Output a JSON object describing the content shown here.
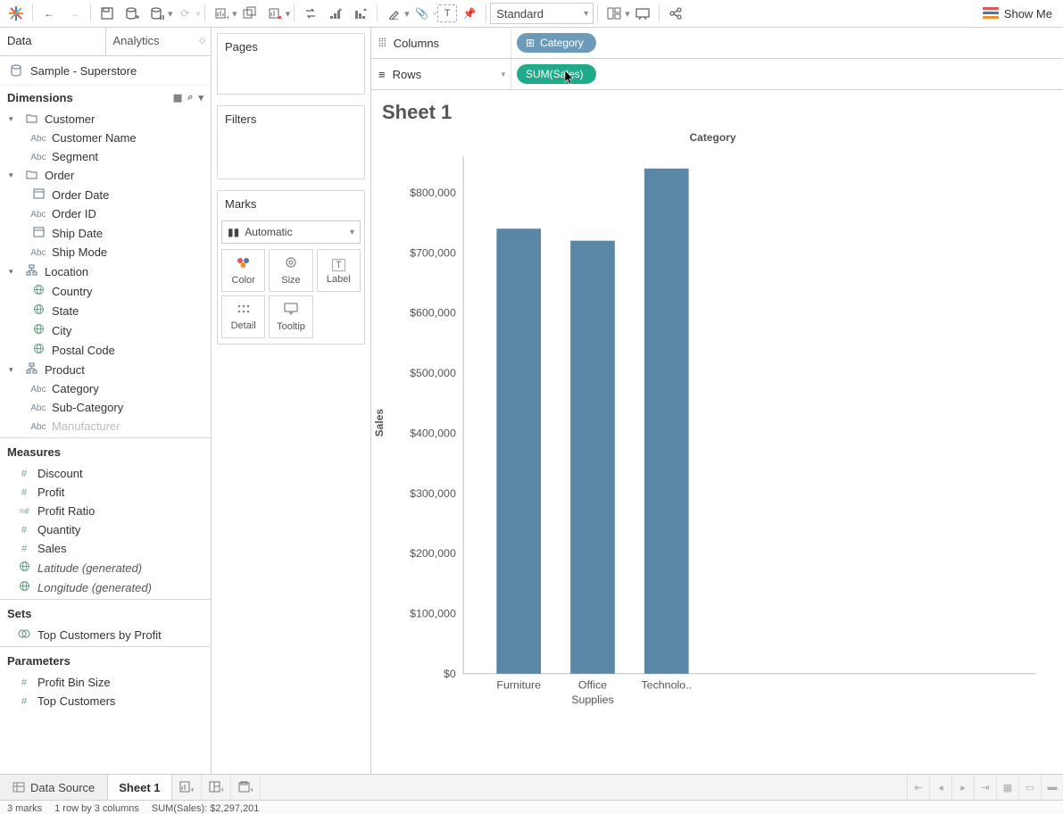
{
  "toolbar": {
    "fit": "Standard",
    "showme": "Show Me"
  },
  "sidebar": {
    "tabs": [
      "Data",
      "Analytics"
    ],
    "datasource": "Sample - Superstore",
    "dimensions_hdr": "Dimensions",
    "groups": [
      {
        "name": "Customer",
        "items": [
          {
            "ico": "Abc",
            "label": "Customer Name"
          },
          {
            "ico": "Abc",
            "label": "Segment"
          }
        ]
      },
      {
        "name": "Order",
        "items": [
          {
            "ico": "cal",
            "label": "Order Date"
          },
          {
            "ico": "Abc",
            "label": "Order ID"
          },
          {
            "ico": "cal",
            "label": "Ship Date"
          },
          {
            "ico": "Abc",
            "label": "Ship Mode"
          }
        ]
      },
      {
        "name": "Location",
        "ico": "hier",
        "items": [
          {
            "ico": "globe",
            "label": "Country"
          },
          {
            "ico": "globe",
            "label": "State"
          },
          {
            "ico": "globe",
            "label": "City"
          },
          {
            "ico": "globe",
            "label": "Postal Code"
          }
        ]
      },
      {
        "name": "Product",
        "ico": "hier",
        "items": [
          {
            "ico": "Abc",
            "label": "Category"
          },
          {
            "ico": "Abc",
            "label": "Sub-Category"
          },
          {
            "ico": "Abc",
            "label": "Manufacturer",
            "cut": true
          }
        ]
      }
    ],
    "measures_hdr": "Measures",
    "measures": [
      {
        "ico": "#",
        "label": "Discount"
      },
      {
        "ico": "#",
        "label": "Profit"
      },
      {
        "ico": "=#",
        "label": "Profit Ratio"
      },
      {
        "ico": "#",
        "label": "Quantity"
      },
      {
        "ico": "#",
        "label": "Sales"
      },
      {
        "ico": "globe",
        "label": "Latitude (generated)",
        "italic": true
      },
      {
        "ico": "globe",
        "label": "Longitude (generated)",
        "italic": true
      }
    ],
    "sets_hdr": "Sets",
    "sets": [
      {
        "ico": "set",
        "label": "Top Customers by Profit"
      }
    ],
    "params_hdr": "Parameters",
    "params": [
      {
        "ico": "#",
        "label": "Profit Bin Size"
      },
      {
        "ico": "#",
        "label": "Top Customers"
      }
    ]
  },
  "middle": {
    "pages": "Pages",
    "filters": "Filters",
    "marks": "Marks",
    "marks_type": "Automatic",
    "buttons": [
      "Color",
      "Size",
      "Label",
      "Detail",
      "Tooltip"
    ]
  },
  "shelves": {
    "columns_label": "Columns",
    "rows_label": "Rows",
    "col_pill": "Category",
    "row_pill": "SUM(Sales)"
  },
  "sheet_title": "Sheet 1",
  "tabbar": {
    "datasource": "Data Source",
    "sheet": "Sheet 1"
  },
  "status": {
    "marks": "3 marks",
    "rows": "1 row by 3 columns",
    "sum": "SUM(Sales): $2,297,201"
  },
  "chart_data": {
    "type": "bar",
    "title": "Category",
    "xlabel": "",
    "ylabel": "Sales",
    "categories": [
      "Furniture",
      "Office Supplies",
      "Technolo.."
    ],
    "category_line2": [
      "",
      "Supplies",
      ""
    ],
    "x_display": [
      [
        "Furniture"
      ],
      [
        "Office",
        "Supplies"
      ],
      [
        "Technolo.."
      ]
    ],
    "values": [
      740000,
      720000,
      840000
    ],
    "yticks": [
      0,
      100000,
      200000,
      300000,
      400000,
      500000,
      600000,
      700000,
      800000
    ],
    "ytick_labels": [
      "$0",
      "$100,000",
      "$200,000",
      "$300,000",
      "$400,000",
      "$500,000",
      "$600,000",
      "$700,000",
      "$800,000"
    ],
    "ylim": [
      0,
      860000
    ],
    "bar_color": "#5b87a6"
  }
}
